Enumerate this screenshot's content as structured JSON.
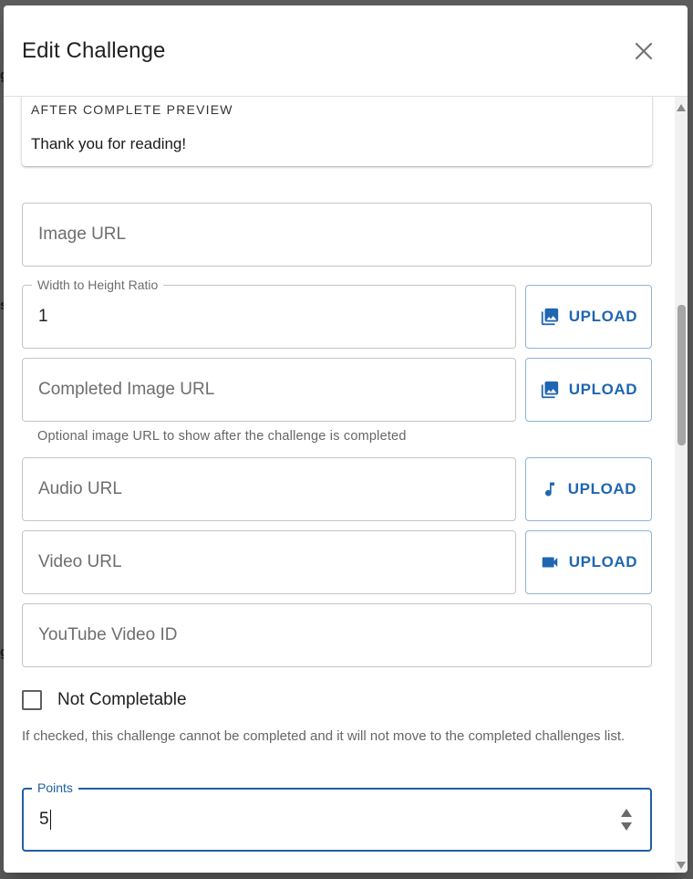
{
  "dialog": {
    "title": "Edit Challenge",
    "close_icon": "close-icon"
  },
  "preview": {
    "label": "AFTER COMPLETE PREVIEW",
    "text": "Thank you for reading!"
  },
  "fields": {
    "image_url": {
      "placeholder": "Image URL",
      "value": ""
    },
    "ratio": {
      "label": "Width to Height Ratio",
      "value": "1"
    },
    "completed_image_url": {
      "placeholder": "Completed Image URL",
      "helper": "Optional image URL to show after the challenge is completed"
    },
    "audio_url": {
      "placeholder": "Audio URL"
    },
    "video_url": {
      "placeholder": "Video URL"
    },
    "youtube_id": {
      "placeholder": "YouTube Video ID"
    },
    "points": {
      "label": "Points",
      "value": "5"
    }
  },
  "upload": {
    "label": "UPLOAD",
    "icons": [
      "image-icon",
      "image-icon",
      "music-note-icon",
      "videocam-icon"
    ]
  },
  "not_completable": {
    "label": "Not Completable",
    "checked": false,
    "helper": "If checked, this challenge cannot be completed and it will not move to the completed challenges list."
  },
  "colors": {
    "accent": "#1f66b0",
    "focus": "#1f5fa3",
    "border": "#c4c4c4"
  }
}
